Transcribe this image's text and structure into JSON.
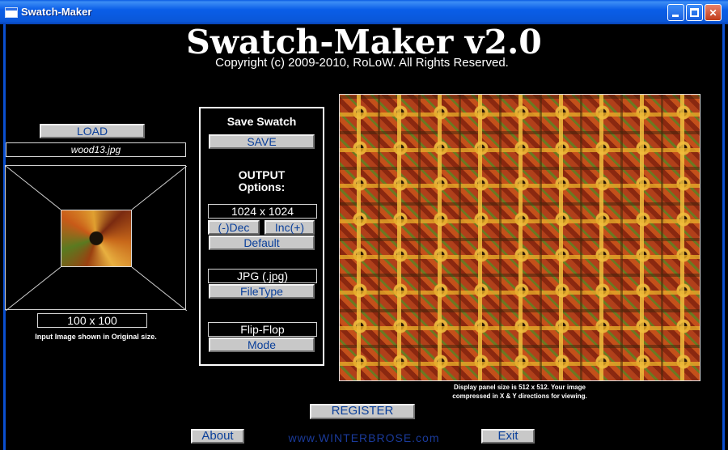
{
  "window": {
    "title": "Swatch-Maker"
  },
  "header": {
    "app_name": "Swatch-Maker v2.0",
    "copyright": "Copyright (c) 2009-2010, RoLoW. All Rights Reserved."
  },
  "input": {
    "load_label": "LOAD",
    "filename": "wood13.jpg",
    "size": "100 x 100",
    "note": "Input Image shown in Original size."
  },
  "controls": {
    "save_heading": "Save Swatch",
    "save_label": "SAVE",
    "output_heading_line1": "OUTPUT",
    "output_heading_line2": "Options:",
    "resolution": "1024 x 1024",
    "dec_label": "(-)Dec",
    "inc_label": "Inc(+)",
    "default_label": "Default",
    "filetype_value": "JPG (.jpg)",
    "filetype_label": "FileType",
    "mode_value": "Flip-Flop",
    "mode_label": "Mode"
  },
  "display": {
    "note_line1": "Display panel size is 512 x 512.  Your image",
    "note_line2": "compressed in X & Y directions for viewing."
  },
  "footer": {
    "register_label": "REGISTER",
    "about_label": "About",
    "website": "www.WINTERBROSE.com",
    "exit_label": "Exit"
  },
  "colors": {
    "titlebar": "#0a5ee8",
    "button_face": "#c8c8c8",
    "button_text": "#0a3f9a",
    "background": "#000000"
  }
}
